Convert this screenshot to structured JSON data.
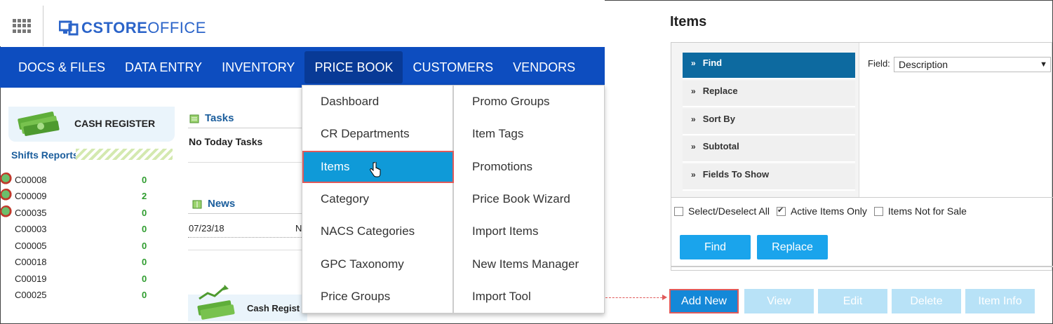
{
  "app": {
    "logo_text_bold": "CSTORE",
    "logo_text": "OFFICE"
  },
  "nav": {
    "items": [
      "DOCS & FILES",
      "DATA ENTRY",
      "INVENTORY",
      "PRICE BOOK",
      "CUSTOMERS",
      "VENDORS"
    ],
    "active": "PRICE BOOK"
  },
  "cash_register": {
    "title": "CASH REGISTER"
  },
  "shifts": {
    "title": "Shifts Reports",
    "rows": [
      {
        "code": "C00008",
        "count": "0"
      },
      {
        "code": "C00009",
        "count": "2"
      },
      {
        "code": "C00035",
        "count": "0"
      },
      {
        "code": "C00003",
        "count": "0"
      },
      {
        "code": "C00005",
        "count": "0"
      },
      {
        "code": "C00018",
        "count": "0"
      },
      {
        "code": "C00019",
        "count": "0"
      },
      {
        "code": "C00025",
        "count": "0"
      }
    ]
  },
  "tasks": {
    "title": "Tasks",
    "empty": "No Today Tasks"
  },
  "news": {
    "title": "News",
    "date": "07/23/18",
    "text_fragment": "N"
  },
  "cash_register_2": {
    "title": "Cash Regist"
  },
  "dropdown": {
    "left": [
      "Dashboard",
      "CR Departments",
      "Items",
      "Category",
      "NACS Categories",
      "GPC Taxonomy",
      "Price Groups"
    ],
    "right": [
      "Promo Groups",
      "Item Tags",
      "Promotions",
      "Price Book Wizard",
      "Import Items",
      "New Items Manager",
      "Import Tool"
    ],
    "highlighted": "Items"
  },
  "items_panel": {
    "title": "Items",
    "sections": [
      "Find",
      "Replace",
      "Sort By",
      "Subtotal",
      "Fields To Show"
    ],
    "selected_section": "Find",
    "field_label": "Field:",
    "field_value": "Description",
    "checkboxes": [
      {
        "label": "Select/Deselect All",
        "checked": false
      },
      {
        "label": "Active Items Only",
        "checked": true
      },
      {
        "label": "Items Not for Sale",
        "checked": false
      }
    ],
    "find_button": "Find",
    "replace_button": "Replace"
  },
  "actions": {
    "add_new": "Add New",
    "view": "View",
    "edit": "Edit",
    "delete": "Delete",
    "item_info": "Item Info"
  },
  "colors": {
    "nav_bg": "#0d4dbf",
    "highlight": "#0f9ad8",
    "callout": "#e05a5a",
    "button": "#1aa4ec"
  }
}
